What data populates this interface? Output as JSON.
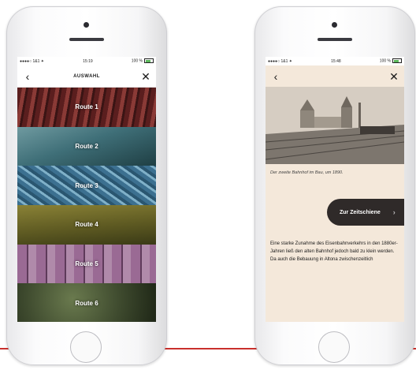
{
  "left_screen": {
    "status": {
      "carrier": "●●●●○ 1&1 ✦",
      "time": "15:19",
      "battery": "100 %"
    },
    "nav": {
      "title": "AUSWAHL"
    },
    "routes": [
      {
        "label": "Route 1",
        "tint": "#7b2a2a"
      },
      {
        "label": "Route 2",
        "tint": "#3f6f78"
      },
      {
        "label": "Route 3",
        "tint": "#4e86a0"
      },
      {
        "label": "Route 4",
        "tint": "#6e6a2a"
      },
      {
        "label": "Route 5",
        "tint": "#8a5a84"
      },
      {
        "label": "Route 6",
        "tint": "#3e4a2e"
      }
    ]
  },
  "right_screen": {
    "status": {
      "carrier": "●●●●○ 1&1 ✦",
      "time": "15:48",
      "battery": "100 %"
    },
    "caption": "Der zweite Bahnhof im Bau, um 1890.",
    "cta": {
      "label": "Zur Zeitschiene"
    },
    "article": "Eine starke Zunahme des Eisenbahnverkehrs in den 1880er-Jahren ließ den alten Bahnhof jedoch bald zu klein werden. Da auch die Bebauung in Altona zwischenzeitlich"
  },
  "accent_color": "#c9302c"
}
